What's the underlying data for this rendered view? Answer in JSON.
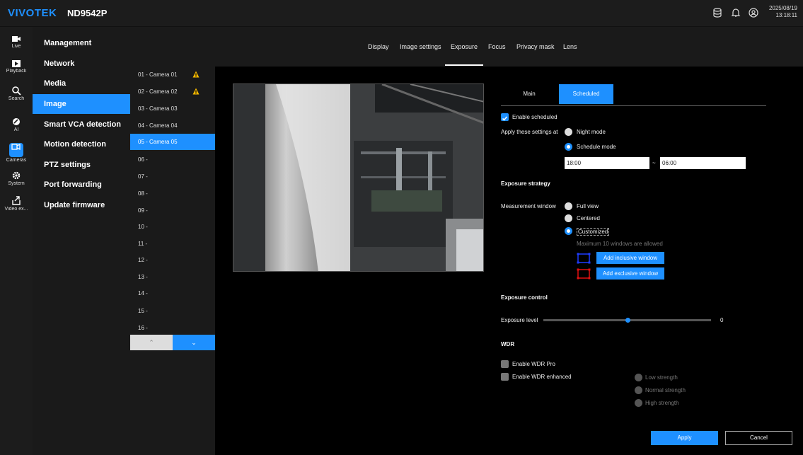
{
  "app": {
    "logo": "VIVOTEK",
    "model": "ND9542P",
    "date": "2025/08/19",
    "time": "13:18:11"
  },
  "rail": [
    {
      "label": "Live",
      "icon": "video-camera-icon"
    },
    {
      "label": "Playback",
      "icon": "playback-icon"
    },
    {
      "label": "Search",
      "icon": "search-icon"
    },
    {
      "label": "AI",
      "icon": "ai-icon"
    },
    {
      "label": "Cameras",
      "icon": "cameras-icon"
    },
    {
      "label": "System",
      "icon": "gear-icon"
    },
    {
      "label": "Video ex...",
      "icon": "export-icon"
    }
  ],
  "menu": [
    "Management",
    "Network",
    "Media",
    "Image",
    "Smart VCA detection",
    "Motion detection",
    "PTZ settings",
    "Port forwarding",
    "Update firmware"
  ],
  "cameras": [
    "01 - Camera 01",
    "02 - Camera 02",
    "03 - Camera 03",
    "04 - Camera 04",
    "05 - Camera 05",
    "06 -",
    "07 -",
    "08 -",
    "09 -",
    "10 -",
    "11 -",
    "12 -",
    "13 -",
    "14 -",
    "15 -",
    "16 -"
  ],
  "cam_nav": {
    "up": "⌃",
    "down": "⌄"
  },
  "tabs": [
    "Display",
    "Image settings",
    "Exposure",
    "Focus",
    "Privacy mask",
    "Lens"
  ],
  "exposure": {
    "seg_main": "Main",
    "seg_scheduled": "Scheduled",
    "enable_scheduled": "Enable scheduled",
    "apply_at": "Apply these settings at",
    "night_mode": "Night mode",
    "schedule_mode": "Schedule mode",
    "from_time": "18:00",
    "sep": "~",
    "to_time": "06:00",
    "strategy_title": "Exposure strategy",
    "measurement_window": "Measurement window",
    "full_view": "Full view",
    "centered": "Centered",
    "customized": "Customized",
    "max_windows": "Maximum 10 windows are allowed",
    "add_inclusive": "Add inclusive window",
    "add_exclusive": "Add exclusive window",
    "control_title": "Exposure control",
    "exposure_level_label": "Exposure level",
    "exposure_level": "0",
    "wdr_title": "WDR",
    "enable_wdr_pro": "Enable WDR Pro",
    "enable_wdr_enhanced": "Enable WDR enhanced",
    "low": "Low strength",
    "normal": "Normal strength",
    "high": "High strength",
    "apply": "Apply",
    "cancel": "Cancel"
  },
  "colors": {
    "accent": "#1e90ff",
    "inclusive": "#1e3cff",
    "exclusive": "#e01010",
    "warning": "#f5b800"
  }
}
